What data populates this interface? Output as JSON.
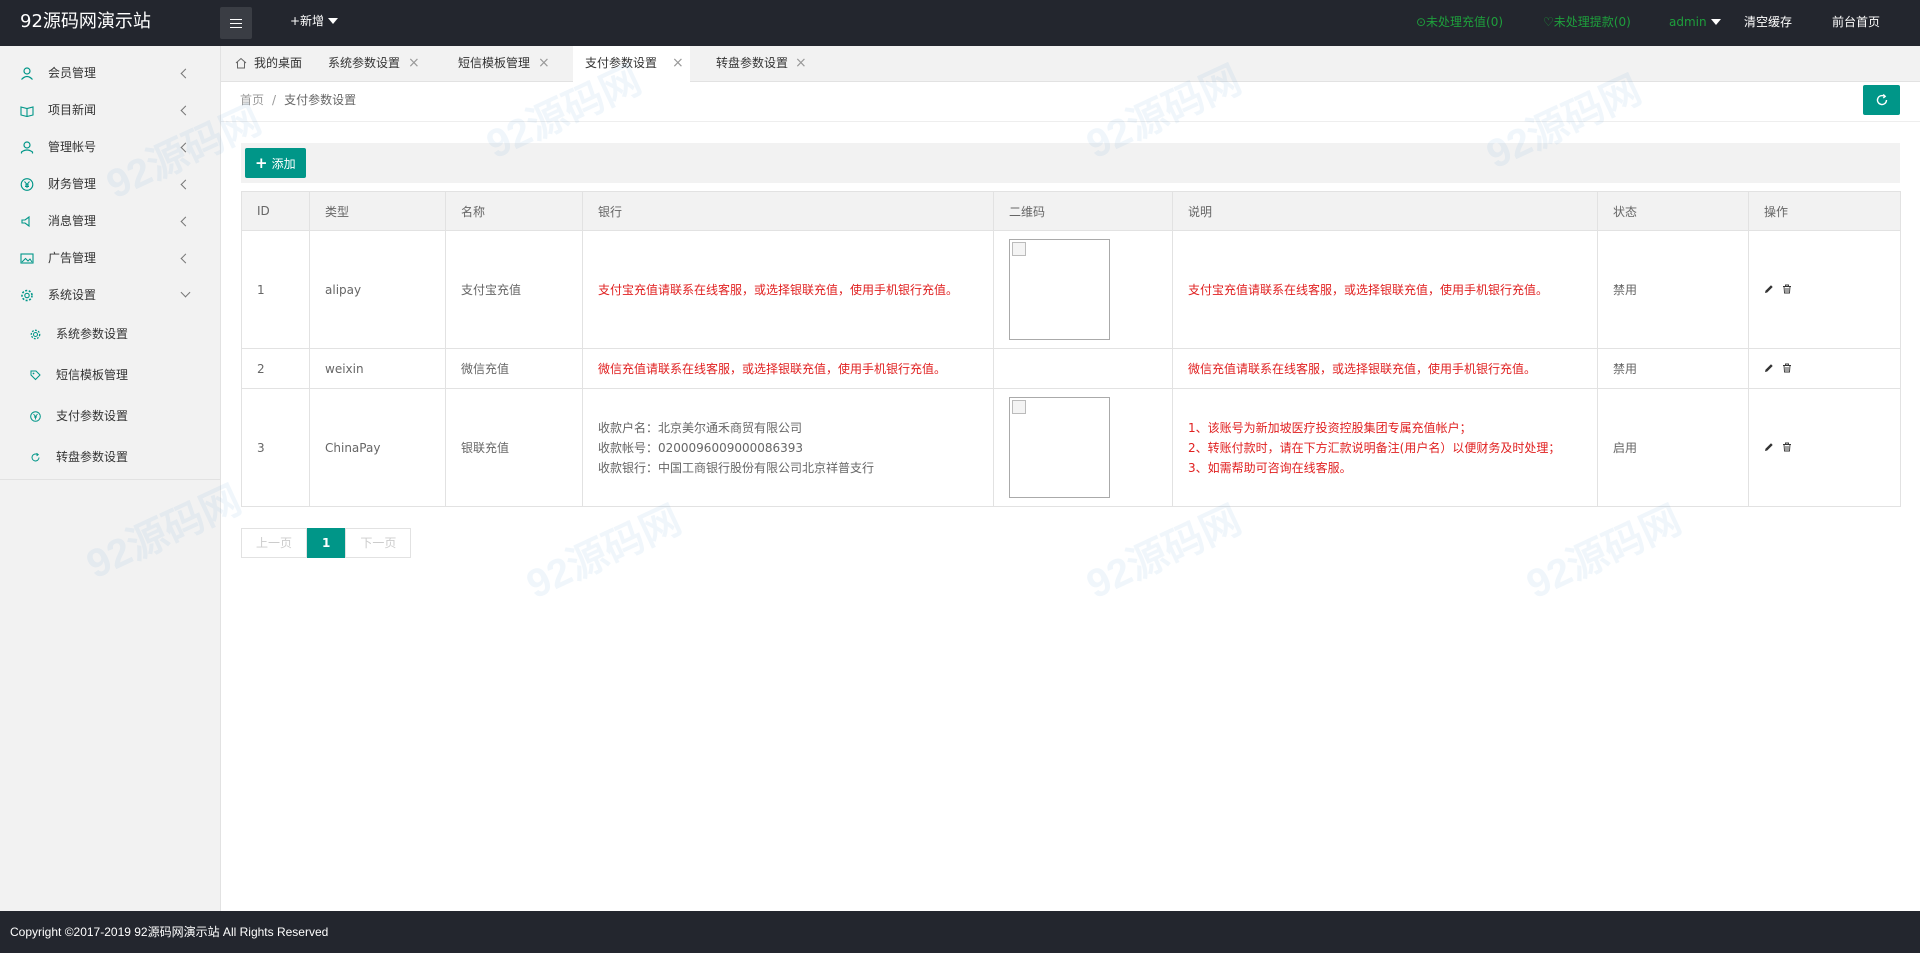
{
  "header": {
    "logo": "92源码网演示站",
    "add_new": "+新增",
    "pending_recharge": "⊙未处理充值(0)",
    "pending_withdraw": "♡未处理提款(0)",
    "admin": "admin",
    "clear_cache": "清空缓存",
    "front_home": "前台首页"
  },
  "sidebar": {
    "items": [
      {
        "label": "会员管理",
        "icon": "user-icon"
      },
      {
        "label": "项目新闻",
        "icon": "book-icon"
      },
      {
        "label": "管理帐号",
        "icon": "person-icon"
      },
      {
        "label": "财务管理",
        "icon": "yen-icon"
      },
      {
        "label": "消息管理",
        "icon": "speaker-icon"
      },
      {
        "label": "广告管理",
        "icon": "image-icon"
      },
      {
        "label": "系统设置",
        "icon": "gear-icon"
      }
    ],
    "subitems": [
      {
        "label": "系统参数设置"
      },
      {
        "label": "短信模板管理"
      },
      {
        "label": "支付参数设置"
      },
      {
        "label": "转盘参数设置"
      }
    ]
  },
  "tabs": [
    {
      "label": "我的桌面"
    },
    {
      "label": "系统参数设置"
    },
    {
      "label": "短信模板管理"
    },
    {
      "label": "支付参数设置"
    },
    {
      "label": "转盘参数设置"
    }
  ],
  "breadcrumb": {
    "home": "首页",
    "sep": "/",
    "current": "支付参数设置"
  },
  "toolbar": {
    "add_label": "添加"
  },
  "table": {
    "headers": [
      "ID",
      "类型",
      "名称",
      "银行",
      "二维码",
      "说明",
      "状态",
      "操作"
    ],
    "rows": [
      {
        "id": "1",
        "type": "alipay",
        "name": "支付宝充值",
        "bank": "支付宝充值请联系在线客服，或选择银联充值，使用手机银行充值。",
        "desc": "支付宝充值请联系在线客服，或选择银联充值，使用手机银行充值。",
        "status": "禁用"
      },
      {
        "id": "2",
        "type": "weixin",
        "name": "微信充值",
        "bank": "微信充值请联系在线客服，或选择银联充值，使用手机银行充值。",
        "desc": "微信充值请联系在线客服，或选择银联充值，使用手机银行充值。",
        "status": "禁用"
      },
      {
        "id": "3",
        "type": "ChinaPay",
        "name": "银联充值",
        "bank_lines": [
          "收款户名：北京美尔通禾商贸有限公司",
          "收款帐号：0200096009000086393",
          "收款银行：中国工商银行股份有限公司北京祥普支行"
        ],
        "desc_lines": [
          "1、该账号为新加坡医疗投资控股集团专属充值帐户；",
          "2、转账付款时，请在下方汇款说明备注(用户名）以便财务及时处理；",
          "3、如需帮助可咨询在线客服。"
        ],
        "status": "启用"
      }
    ]
  },
  "pager": {
    "prev": "上一页",
    "current": "1",
    "next": "下一页"
  },
  "footer": {
    "copyright": "Copyright ©2017-2019 92源码网演示站 All Rights Reserved"
  },
  "colors": {
    "primary": "#009688",
    "header_bg": "#23262e",
    "danger": "#e02020",
    "pending": "#1e9f3c"
  }
}
